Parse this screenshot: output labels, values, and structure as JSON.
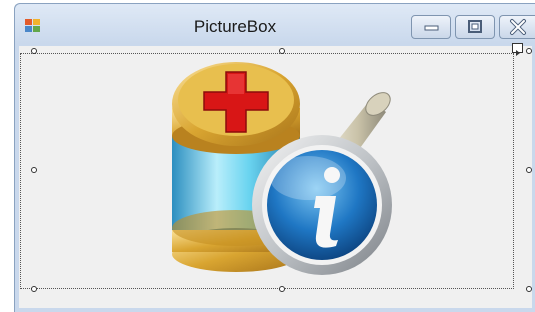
{
  "window": {
    "title": "PictureBox",
    "controls": {
      "minimize_icon": "minimize-icon",
      "maximize_icon": "maximize-icon",
      "close_icon": "close-icon"
    }
  },
  "picture_box": {
    "image_icons": [
      "database-add-icon",
      "info-magnifier-icon"
    ]
  },
  "colors": {
    "title_bar": "#c9d8ec",
    "client_background": "#f0f0f0",
    "selection_border": "#555555"
  }
}
